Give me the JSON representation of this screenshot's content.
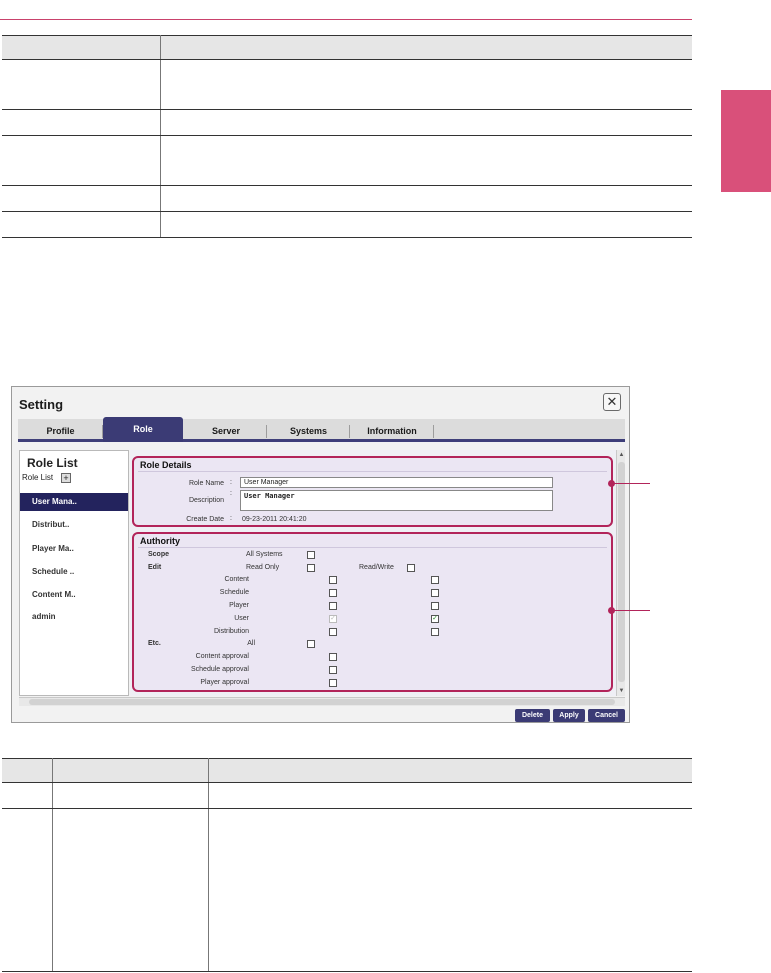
{
  "colors": {
    "accent": "#d9507a",
    "dialog_nav": "#3b3b75",
    "highlight_box": "#b2245a"
  },
  "dialog": {
    "title": "Setting",
    "close_icon": "close-icon",
    "tabs": [
      "Profile",
      "Role",
      "Server",
      "Systems",
      "Information"
    ],
    "active_tab": "Role",
    "role_list": {
      "title": "Role List",
      "subtitle": "Role List",
      "items": [
        "User Mana..",
        "Distribut..",
        "Player Ma..",
        "Schedule ..",
        "Content M..",
        "admin"
      ],
      "selected": "User Mana.."
    },
    "role_details": {
      "header": "Role Details",
      "role_name_label": "Role Name",
      "role_name_value": "User Manager",
      "description_label": "Description",
      "description_value": "User Manager",
      "create_date_label": "Create Date",
      "create_date_value": "09-23-2011 20:41:20"
    },
    "authority": {
      "header": "Authority",
      "scope_label": "Scope",
      "all_systems_label": "All Systems",
      "edit_label": "Edit",
      "read_only_label": "Read Only",
      "read_write_label": "Read/Write",
      "edit_items": [
        "Content",
        "Schedule",
        "Player",
        "User",
        "Distribution"
      ],
      "etc_label": "Etc.",
      "all_label": "All",
      "approval_items": [
        "Content approval",
        "Schedule approval",
        "Player approval"
      ]
    },
    "buttons": {
      "delete": "Delete",
      "apply": "Apply",
      "cancel": "Cancel"
    }
  }
}
